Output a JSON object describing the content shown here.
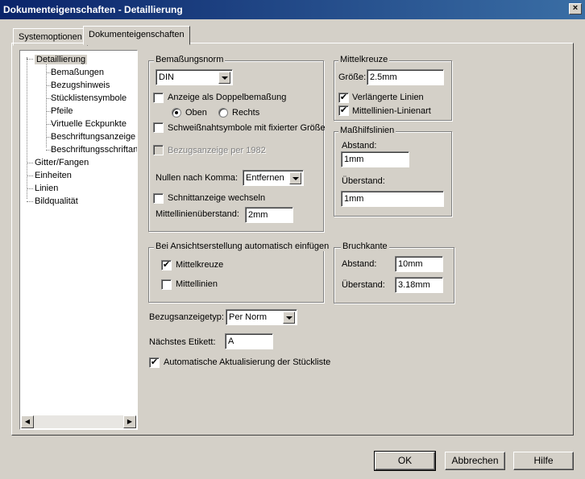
{
  "window": {
    "title": "Dokumenteigenschaften - Detaillierung",
    "close_glyph": "×"
  },
  "tabs": [
    {
      "label": "Systemoptionen"
    },
    {
      "label": "Dokumenteigenschaften"
    }
  ],
  "tree": {
    "items": [
      {
        "label": "Detaillierung"
      },
      {
        "label": "Bemaßungen"
      },
      {
        "label": "Bezugshinweis"
      },
      {
        "label": "Stücklistensymbole"
      },
      {
        "label": "Pfeile"
      },
      {
        "label": "Virtuelle Eckpunkte"
      },
      {
        "label": "Beschriftungsanzeige"
      },
      {
        "label": "Beschriftungsschriftart"
      },
      {
        "label": "Gitter/Fangen"
      },
      {
        "label": "Einheiten"
      },
      {
        "label": "Linien"
      },
      {
        "label": "Bildqualität"
      }
    ],
    "scroll_left": "◀",
    "scroll_right": "▶"
  },
  "bemassungsnorm": {
    "title": "Bemaßungsnorm",
    "norm_value": "DIN",
    "doppel_label": "Anzeige als Doppelbemaßung",
    "oben_label": "Oben",
    "rechts_label": "Rechts",
    "schweiss_label": "Schweißnahtsymbole mit fixierter Größe",
    "bezug1982_label": "Bezugsanzeige per 1982",
    "nullen_label": "Nullen nach Komma:",
    "nullen_value": "Entfernen",
    "schnitt_label": "Schnittanzeige wechseln",
    "mittellinien_label": "Mittellinienüberstand:",
    "mittellinien_value": "2mm"
  },
  "mittelkreuze": {
    "title": "Mittelkreuze",
    "groesse_label": "Größe:",
    "groesse_value": "2.5mm",
    "verl_label": "Verlängerte Linien",
    "linienart_label": "Mittellinien-Linienart",
    "check": "✔"
  },
  "masshilfslinien": {
    "title": "Maßhilfslinien",
    "abstand_label": "Abstand:",
    "abstand_value": "1mm",
    "ueberstand_label": "Überstand:",
    "ueberstand_value": "1mm"
  },
  "ansicht": {
    "title": "Bei Ansichtserstellung automatisch einfügen",
    "mittelkreuze_label": "Mittelkreuze",
    "mittellinien_label": "Mittellinien"
  },
  "bruchkante": {
    "title": "Bruchkante",
    "abstand_label": "Abstand:",
    "abstand_value": "10mm",
    "ueberstand_label": "Überstand:",
    "ueberstand_value": "3.18mm"
  },
  "misc": {
    "bezugstyp_label": "Bezugsanzeigetyp:",
    "bezugstyp_value": "Per Norm",
    "etikett_label": "Nächstes Etikett:",
    "etikett_value": "A",
    "auto_label": "Automatische Aktualisierung der Stückliste"
  },
  "buttons": {
    "ok": "OK",
    "cancel": "Abbrechen",
    "help": "Hilfe"
  }
}
